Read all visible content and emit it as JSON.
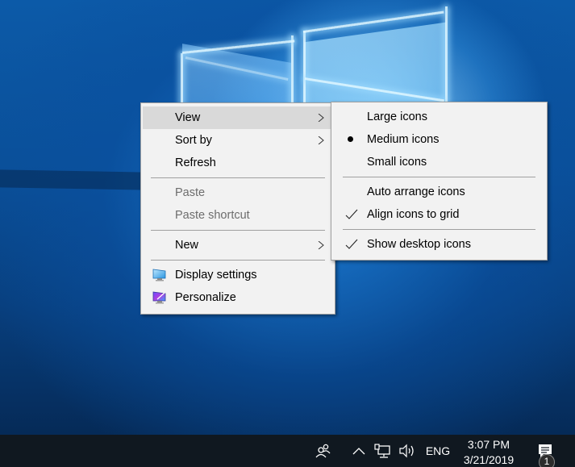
{
  "context_menu": {
    "items": [
      {
        "label": "View",
        "state": "highlighted",
        "has_submenu": true
      },
      {
        "label": "Sort by",
        "has_submenu": true
      },
      {
        "label": "Refresh"
      },
      {
        "separator": true
      },
      {
        "label": "Paste",
        "state": "disabled"
      },
      {
        "label": "Paste shortcut",
        "state": "disabled"
      },
      {
        "separator": true
      },
      {
        "label": "New",
        "has_submenu": true
      },
      {
        "separator": true
      },
      {
        "label": "Display settings",
        "icon": "display-settings-icon"
      },
      {
        "label": "Personalize",
        "icon": "personalize-icon"
      }
    ]
  },
  "view_submenu": {
    "items": [
      {
        "label": "Large icons",
        "selected": false
      },
      {
        "label": "Medium icons",
        "selected": true,
        "mark": "bullet"
      },
      {
        "label": "Small icons",
        "selected": false
      },
      {
        "separator": true
      },
      {
        "label": "Auto arrange icons",
        "checked": false
      },
      {
        "label": "Align icons to grid",
        "checked": true,
        "mark": "check"
      },
      {
        "separator": true
      },
      {
        "label": "Show desktop icons",
        "checked": true,
        "mark": "check"
      }
    ]
  },
  "taskbar": {
    "people_icon": "people-icon",
    "hidden_icons_icon": "chevron-up-icon",
    "network_icon": "network-icon",
    "volume_icon": "volume-icon",
    "language": "ENG",
    "time": "3:07 PM",
    "date": "3/21/2019",
    "action_center_icon": "action-center-icon",
    "notification_count": "1"
  },
  "colors": {
    "menu_background": "#f2f2f2",
    "menu_highlight": "#d9d9d9",
    "menu_border": "#a0a0a0",
    "disabled_text": "#6d6d6d",
    "taskbar_background": "#101820"
  }
}
